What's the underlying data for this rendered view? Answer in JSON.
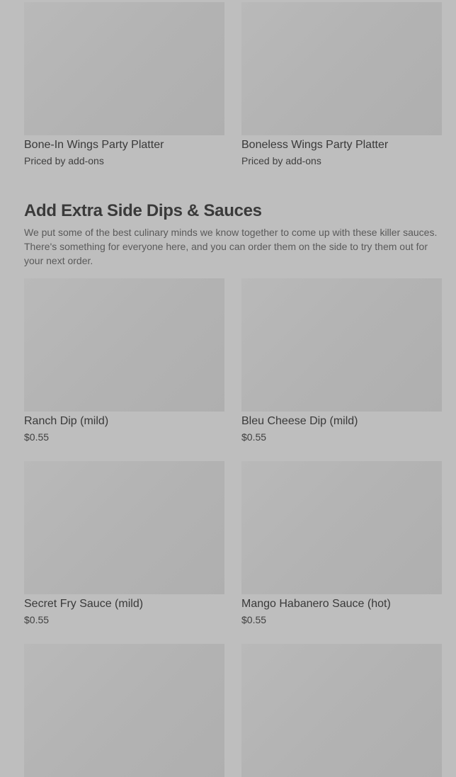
{
  "top_items": [
    {
      "name": "Bone-In Wings Party Platter",
      "price": "Priced by add-ons"
    },
    {
      "name": "Boneless Wings Party Platter",
      "price": "Priced by add-ons"
    }
  ],
  "section": {
    "title": "Add Extra Side Dips & Sauces",
    "description": "We put some of the best culinary minds we know together to come up with these killer sauces. There's something for everyone here, and you can order them on the side to try them out for your next order."
  },
  "items": [
    {
      "name": "Ranch Dip (mild)",
      "price": "$0.55"
    },
    {
      "name": "Bleu Cheese Dip (mild)",
      "price": "$0.55"
    },
    {
      "name": "Secret Fry Sauce (mild)",
      "price": "$0.55"
    },
    {
      "name": "Mango Habanero Sauce (hot)",
      "price": "$0.55"
    }
  ]
}
